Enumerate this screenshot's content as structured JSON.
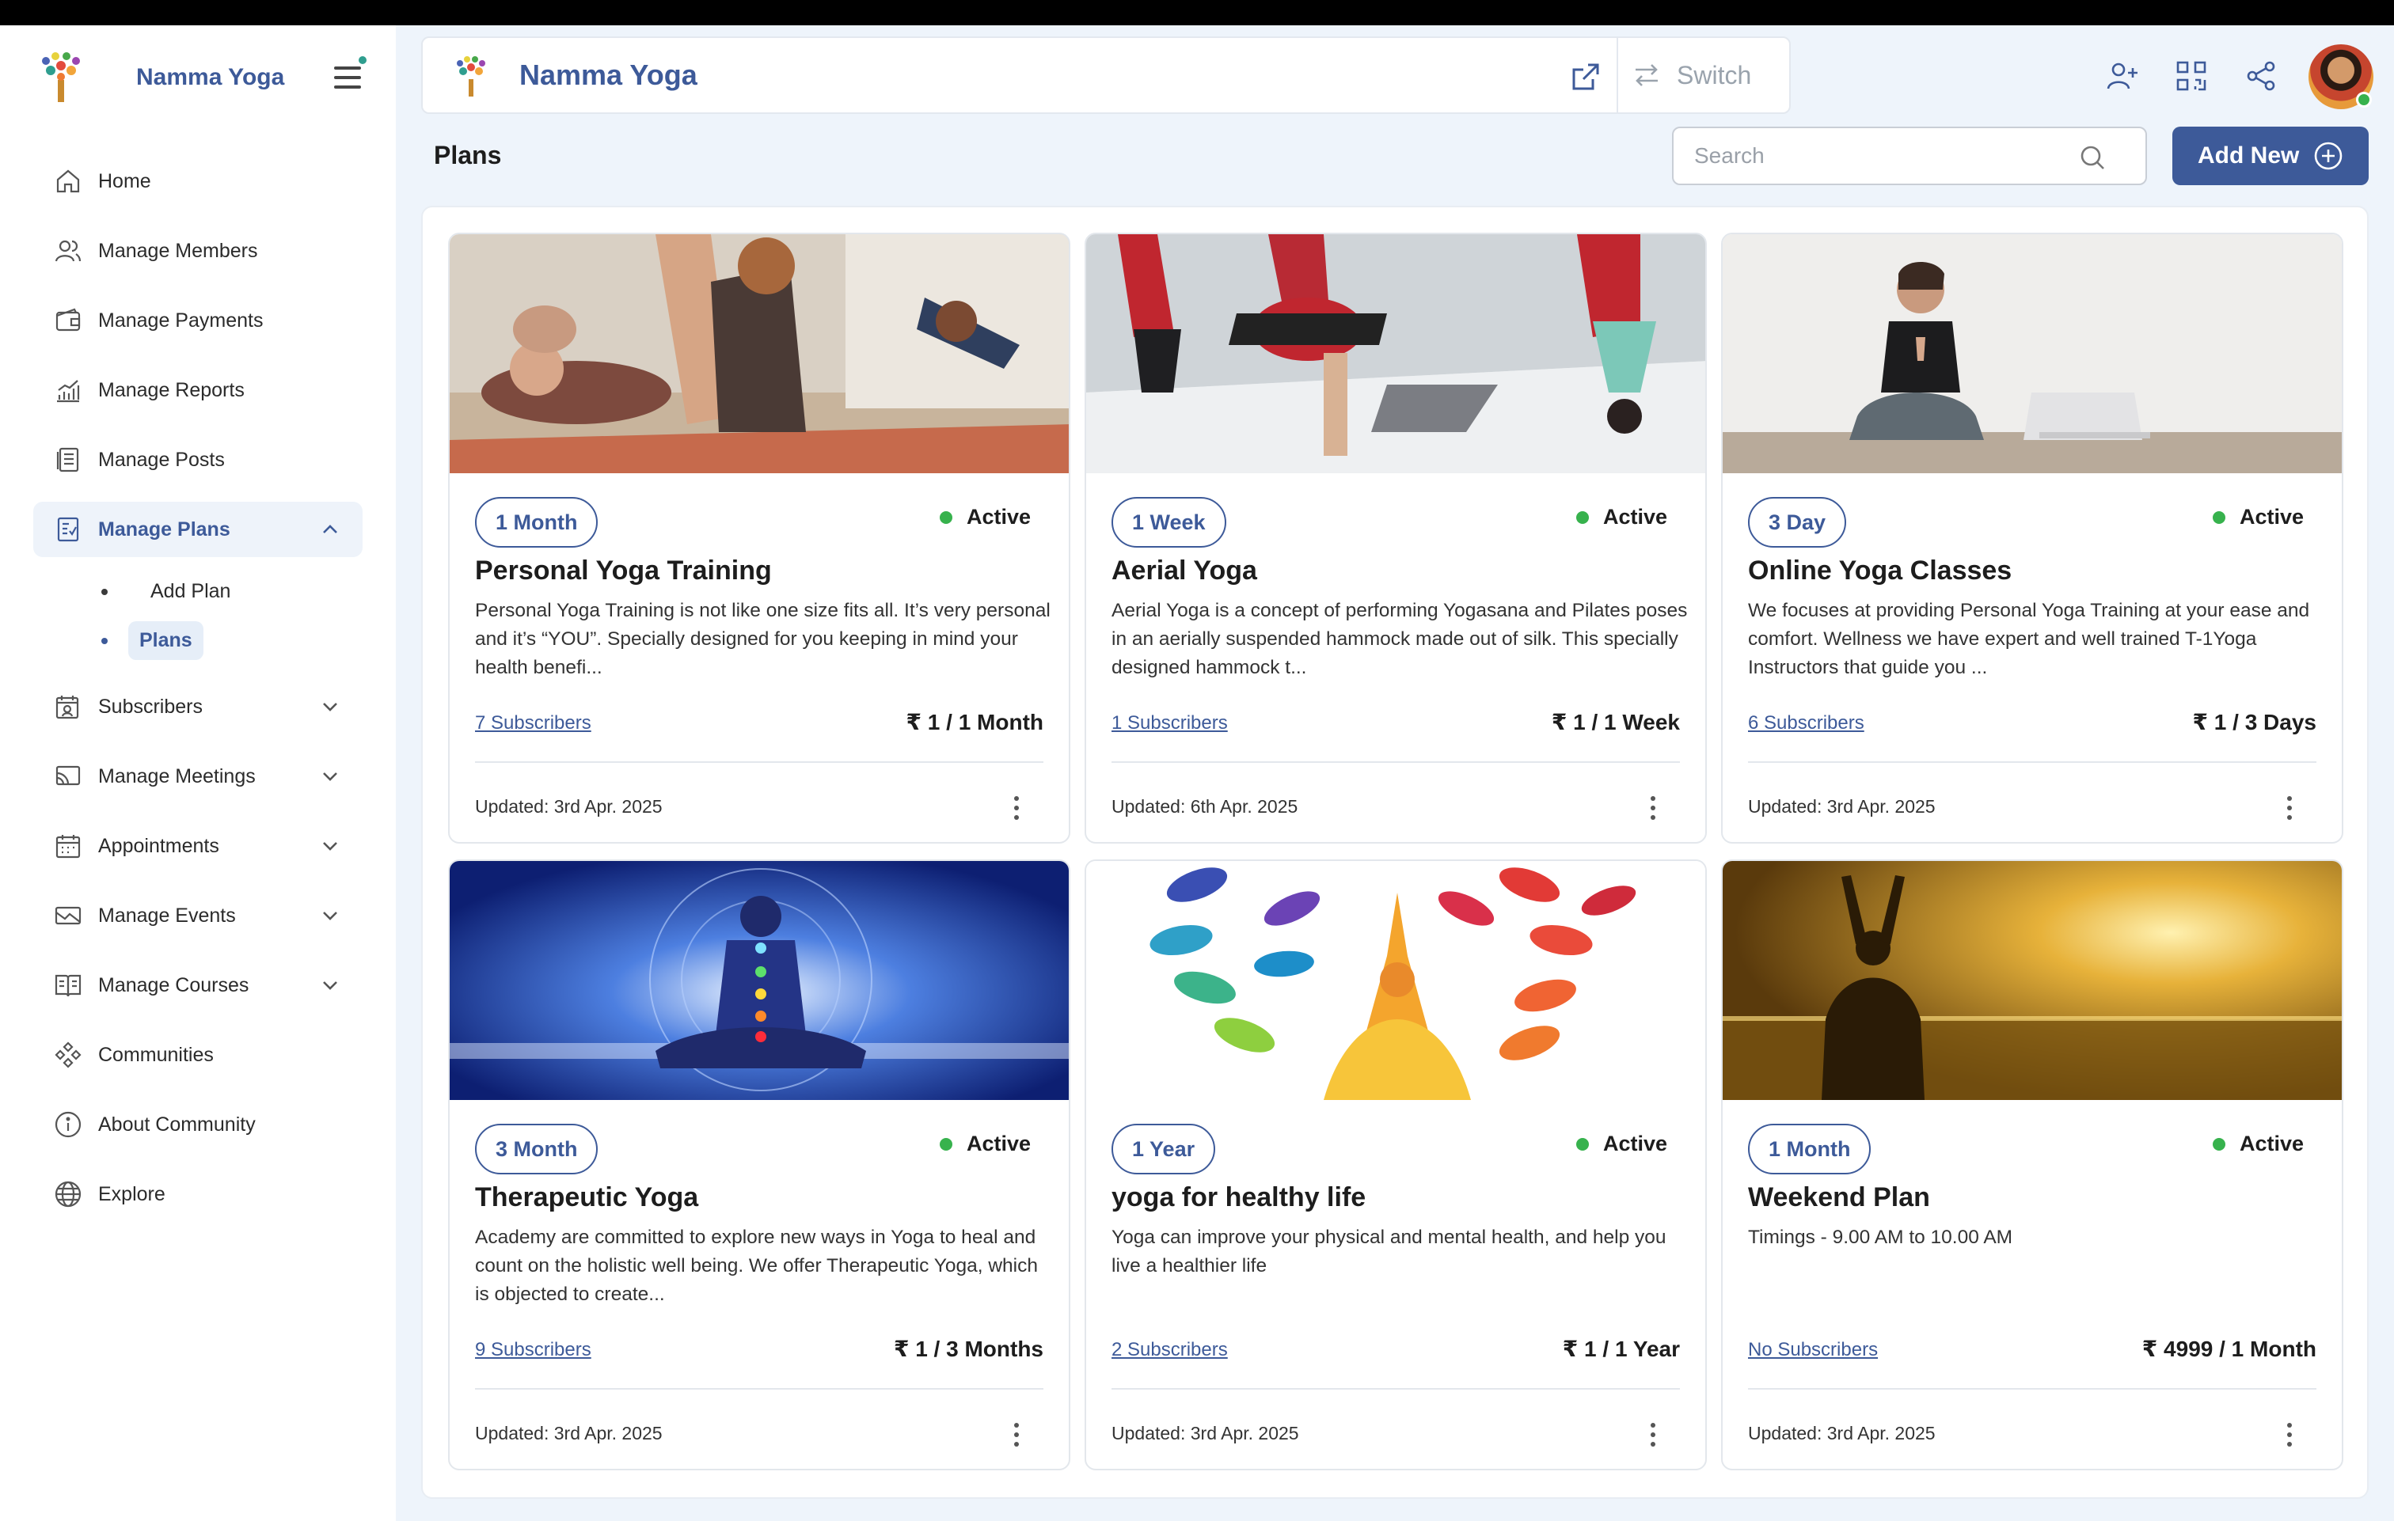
{
  "app": {
    "brand_name": "Namma Yoga",
    "workspace_title": "Namma Yoga",
    "switch_label": "Switch"
  },
  "sidebar": {
    "items": [
      {
        "label": "Home",
        "icon": "home-icon"
      },
      {
        "label": "Manage Members",
        "icon": "members-icon"
      },
      {
        "label": "Manage Payments",
        "icon": "wallet-icon"
      },
      {
        "label": "Manage Reports",
        "icon": "chart-icon"
      },
      {
        "label": "Manage Posts",
        "icon": "posts-icon"
      },
      {
        "label": "Manage Plans",
        "icon": "plans-icon",
        "expanded": true
      },
      {
        "label": "Subscribers",
        "icon": "subscribers-icon"
      },
      {
        "label": "Manage Meetings",
        "icon": "meetings-icon"
      },
      {
        "label": "Appointments",
        "icon": "calendar-icon"
      },
      {
        "label": "Manage Events",
        "icon": "events-icon"
      },
      {
        "label": "Manage Courses",
        "icon": "book-icon"
      },
      {
        "label": "Communities",
        "icon": "communities-icon"
      },
      {
        "label": "About Community",
        "icon": "info-icon"
      },
      {
        "label": "Explore",
        "icon": "globe-icon"
      }
    ],
    "plans_sub": [
      {
        "label": "Add Plan"
      },
      {
        "label": "Plans",
        "active": true
      }
    ]
  },
  "page": {
    "title": "Plans",
    "search_placeholder": "Search",
    "add_new_label": "Add New"
  },
  "colors": {
    "brand": "#3d5a99",
    "active_status": "#37b24d",
    "page_bg": "#eef4fb"
  },
  "plans": [
    {
      "duration": "1 Month",
      "status": "Active",
      "title": "Personal Yoga Training",
      "description": "Personal Yoga Training is not like one size fits all. It’s very personal and it’s “YOU”. Specially designed for you keeping in mind your health benefi...",
      "subscribers": "7 Subscribers",
      "price": "₹ 1 / 1 Month",
      "updated": "Updated: 3rd Apr. 2025"
    },
    {
      "duration": "1 Week",
      "status": "Active",
      "title": "Aerial Yoga",
      "description": "Aerial Yoga is a concept of performing Yogasana and Pilates poses in an aerially suspended hammock made out of silk. This specially designed hammock t...",
      "subscribers": "1 Subscribers",
      "price": "₹ 1 / 1 Week",
      "updated": "Updated: 6th Apr. 2025"
    },
    {
      "duration": "3 Day",
      "status": "Active",
      "title": "Online Yoga Classes",
      "description": "We focuses at providing Personal Yoga Training at your ease and comfort. Wellness we have expert and well trained T-1Yoga Instructors that guide you ...",
      "subscribers": "6 Subscribers",
      "price": "₹ 1 / 3 Days",
      "updated": "Updated: 3rd Apr. 2025"
    },
    {
      "duration": "3 Month",
      "status": "Active",
      "title": "Therapeutic Yoga",
      "description": "Academy are committed to explore new ways in Yoga to heal and count on the holistic well being. We offer Therapeutic Yoga, which is objected to create...",
      "subscribers": "9 Subscribers",
      "price": "₹ 1 / 3 Months",
      "updated": "Updated: 3rd Apr. 2025"
    },
    {
      "duration": "1 Year",
      "status": "Active",
      "title": "yoga for healthy life",
      "description": "Yoga can improve your physical and mental health, and help you live a healthier life",
      "subscribers": "2 Subscribers",
      "price": "₹ 1 / 1 Year",
      "updated": "Updated: 3rd Apr. 2025"
    },
    {
      "duration": "1 Month",
      "status": "Active",
      "title": "Weekend Plan",
      "description": "Timings - 9.00 AM to 10.00 AM",
      "subscribers": "No Subscribers",
      "price": "₹ 4999 / 1 Month",
      "updated": "Updated: 3rd Apr. 2025"
    }
  ]
}
